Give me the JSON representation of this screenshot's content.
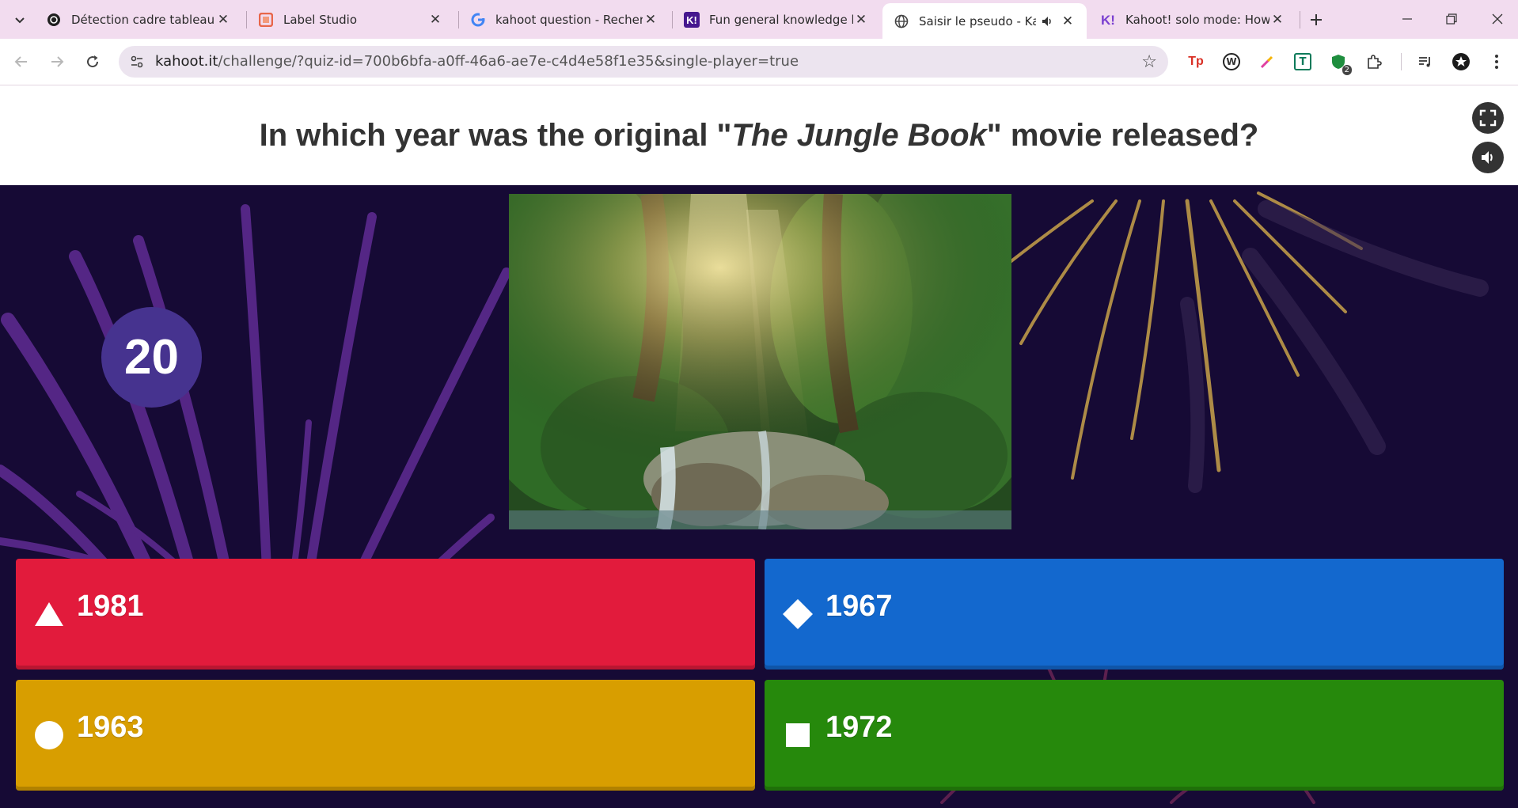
{
  "tabs": [
    {
      "title": "Détection cadre tableau",
      "favicon": "openai-logo-icon"
    },
    {
      "title": "Label Studio",
      "favicon": "label-studio-icon"
    },
    {
      "title": "kahoot question - Recherch",
      "favicon": "google-g-icon"
    },
    {
      "title": "Fun general knowledge kah",
      "favicon": "kahoot-k-icon"
    },
    {
      "title": "Saisir le pseudo - Kaho",
      "favicon": "globe-icon"
    },
    {
      "title": "Kahoot! solo mode: How to",
      "favicon": "kahoot-k-icon"
    }
  ],
  "address_bar": {
    "host": "kahoot.it",
    "path": "/challenge/?quiz-id=700b6bfa-a0ff-46a6-ae7e-c4d4e58f1e35&single-player=true"
  },
  "extensions": [
    "Tp",
    "W",
    "T",
    "2"
  ],
  "question": {
    "prefix": "In which year was the original \"",
    "italic": "The Jungle Book",
    "suffix": "\" movie released?"
  },
  "timer": "20",
  "image": {
    "description_icon": "jungle-waterfall-image"
  },
  "answers": [
    {
      "shape": "triangle",
      "label": "1981",
      "color": "#e21b3c"
    },
    {
      "shape": "diamond",
      "label": "1967",
      "color": "#1368ce"
    },
    {
      "shape": "circle",
      "label": "1963",
      "color": "#d89e00"
    },
    {
      "shape": "square",
      "label": "1972",
      "color": "#26890c"
    }
  ],
  "colors": {
    "tabbar": "#f2dcef",
    "stage_bg": "#160a35",
    "timer_bg": "#46338f"
  }
}
